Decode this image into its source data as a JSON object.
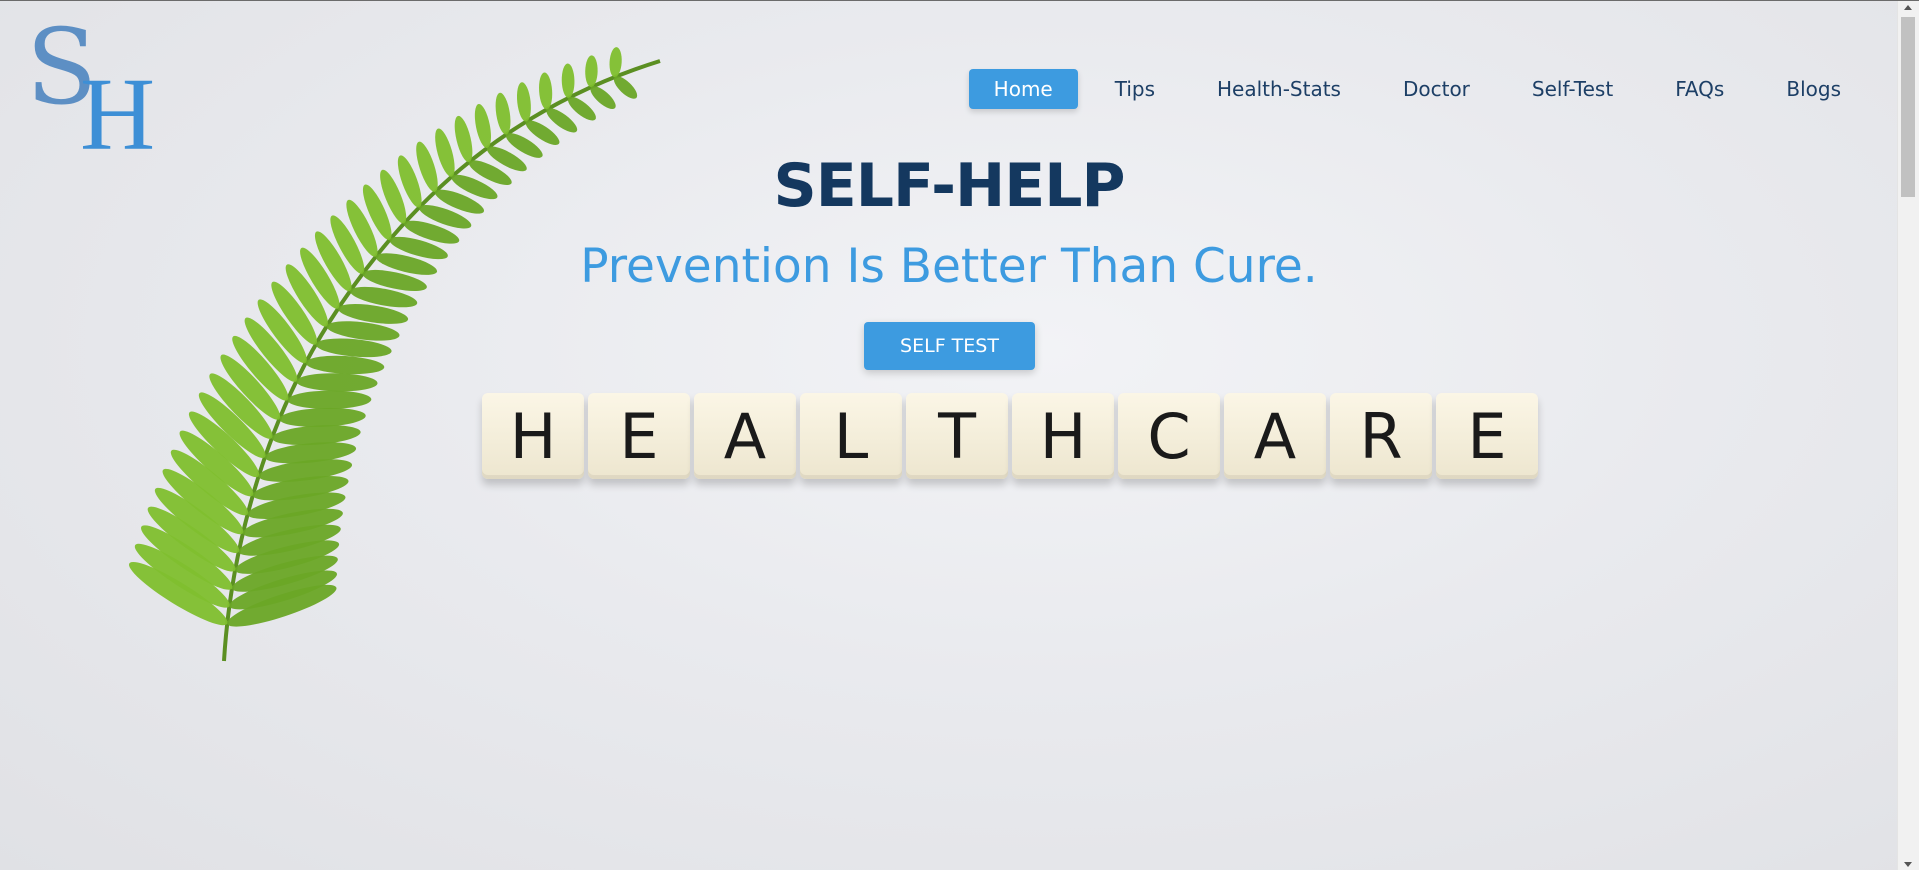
{
  "logo": {
    "letter1": "S",
    "letter2": "H"
  },
  "nav": {
    "items": [
      {
        "label": "Home"
      },
      {
        "label": "Tips"
      },
      {
        "label": "Health-Stats"
      },
      {
        "label": "Doctor"
      },
      {
        "label": "Self-Test"
      },
      {
        "label": "FAQs"
      },
      {
        "label": "Blogs"
      }
    ]
  },
  "hero": {
    "title": "SELF-HELP",
    "subtitle": "Prevention Is Better Than Cure.",
    "cta_label": "SELF TEST",
    "tiles": [
      "H",
      "E",
      "A",
      "L",
      "T",
      "H",
      "C",
      "A",
      "R",
      "E"
    ]
  },
  "colors": {
    "accent": "#3d9be0",
    "title": "#14385f",
    "nav_text": "#1d3f66",
    "fern": "#7ab528"
  },
  "icons": {
    "hero_image": "fern-leaf",
    "scroll_up": "scroll-up-arrow-icon",
    "scroll_down": "scroll-down-arrow-icon"
  }
}
